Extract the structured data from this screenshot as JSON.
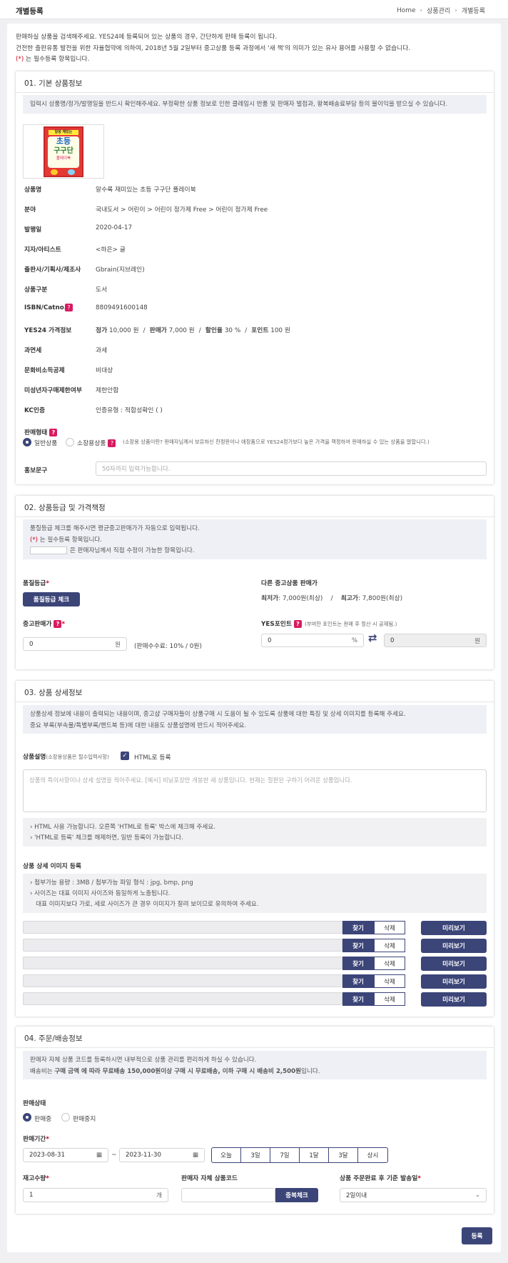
{
  "header": {
    "title": "개별등록",
    "breadcrumb": [
      "Home",
      "상품관리",
      "개별등록"
    ]
  },
  "intro": {
    "line1": "판매하실 상품을 검색해주세요. YES24에 등록되어 있는 상품의 경우, 간단하게 판매 등록이 됩니다.",
    "line2": "건전한 출판유통 발전을 위한 자율협약에 의하여, 2018년 5월 2일부터 중고상품 등록 과정에서 '새 책'의 의미가 있는 유사 용어를 사용할 수 없습니다.",
    "req_mark": "(*)",
    "req_text": " 는 필수등록 항목입니다."
  },
  "sec1": {
    "title": "01. 기본 상품정보",
    "notice": "입력시 상품명/정가/발행일을 반드시 확인해주세요. 부정확한 상품 정보로 인한 클레임시 반품 및 판매자 벌점과, 왕복배송료부담 등의 불이익을 받으실 수 있습니다.",
    "cover": {
      "badge": "알쏭 재밌는",
      "big1": "초등",
      "big2": "구구단",
      "sub": "플레이북"
    },
    "fields": [
      {
        "label": "상품명",
        "value": "알수록 재미있는 초등 구구단 플레이북"
      },
      {
        "label": "분야",
        "value": "국내도서 > 어린이 > 어린이 정가제 Free > 어린이 정가제 Free"
      },
      {
        "label": "발행일",
        "value": "2020-04-17"
      },
      {
        "label": "지자/아티스트",
        "value": "<하은> 글"
      },
      {
        "label": "출판사/기획사/제조사",
        "value": "Gbrain(지브레인)"
      },
      {
        "label": "상품구분",
        "value": "도서"
      },
      {
        "label": "ISBN/Catno.",
        "value": "8809491600148"
      },
      {
        "label": "YES24 가격정보",
        "value": ""
      },
      {
        "label": "과면세",
        "value": "과세"
      },
      {
        "label": "문화비소득공제",
        "value": "비대상"
      },
      {
        "label": "미성년자구매제한여부",
        "value": "제한안함"
      },
      {
        "label": "KC인증",
        "value": "인증유형 : 적합성확인 ( )"
      }
    ],
    "price": {
      "l1": "정가",
      "v1": " 10,000 원",
      "s1": "/",
      "l2": "판매가",
      "v2": " 7,000 원",
      "s2": "/",
      "l3": "할인율",
      "v3": " 30 %",
      "s3": "/",
      "l4": "포인트",
      "v4": " 100 원"
    },
    "sale_type": {
      "label": "판매형태",
      "opt1": "일반상품",
      "opt2": "소장용상품",
      "note": "(소장용 상품이란? 판매자님께서 보유하신 한정판이나 애장품으로 YES24정가보다 높은 가격을 책정하여 판매하실 수 있는 상품을 말합니다.)"
    },
    "promo": {
      "label": "홍보문구",
      "placeholder": "50자까지 입력가능합니다."
    }
  },
  "sec2": {
    "title": "02. 상품등급 및 가격책정",
    "n1": "품질등급 체크를 해주시면 평균중고판매가가 자동으로 입력됩니다.",
    "n2_mark": "(*)",
    "n2": " 는 필수등록 항목입니다.",
    "n3": "은 판매자님께서 직접 수정이 가능한 항목입니다.",
    "grade_label": "품질등급",
    "grade_btn": "품질등급 체크",
    "other_label": "다른 중고상품 판매가",
    "min_l": "최저가",
    "min_v": ": 7,000원(최상)",
    "slash": "/",
    "max_l": "최고가",
    "max_v": ": 7,800원(최상)",
    "used_label": "중고판매가",
    "used_value": "0",
    "won": "원",
    "fee": "(판매수수료: 10% / 0원)",
    "yes_label": "YES포인트",
    "yes_note": "(부여한 포인트는 판매 후 정산 시 공제됨.)",
    "pct_value": "0",
    "pct": "%",
    "swap": "⇄",
    "pt_value": "0",
    "pt_won": "원"
  },
  "sec3": {
    "title": "03. 상품 상세정보",
    "n1": "상품상세 정보에 내용이 출력되는 내용이며, 중고샵 구매자들이 상품구매 시 도움이 될 수 있도록 상품에 대한 특징 및 상세 이미지를 등록해 주세요.",
    "n2": "중요 부록(부속물/특별부록/핸드북 등)에 대한 내용도 상품설명에 반드시 적어주세요.",
    "desc_label": "상품설명",
    "desc_note": "(소장용상품은 필수입력사항)",
    "html_check": "HTML로 등록",
    "desc_placeholder": "상품의 특이사항이나 상세 설명을 적어주세요. [예시] 비닐포장만 개봉한 새 상품입니다. 현재는 절판된 구하기 어려운 상품입니다.",
    "tips": [
      "HTML 사용 가능합니다. 오른쪽 'HTML로 등록' 박스에 체크해 주세요.",
      "'HTML로 등록' 체크를 해제하면, 일반 등록이 가능합니다."
    ],
    "img_label": "상품 상세 이미지 등록",
    "img_tips": [
      "첨부가능 용량 : 3MB / 첨부가능 파일 형식 : jpg, bmp, png",
      "사이즈는 대표 이미지 사이즈와 동일하게 노출됩니다.",
      "대표 이미지보다 가로, 세로 사이즈가 큰 경우 이미지가 잘려 보이므로 유의하여 주세요."
    ],
    "find": "찾기",
    "del": "삭제",
    "preview": "미리보기"
  },
  "sec4": {
    "title": "04. 주문/배송정보",
    "n1": "판매자 자체 상품 코드를 등록하시면 내부적으로 상품 관리를 편리하게 하실 수 있습니다.",
    "n2a": "배송비는 ",
    "n2b": "구매 금액 에 따라 무료배송 150,000원이상 구매 시 무료배송, 이하 구매 시 배송비 2,500원",
    "n2c": "입니다.",
    "status_label": "판매상태",
    "st1": "판매중",
    "st2": "판매중지",
    "period_label": "판매기간",
    "date_from": "2023-08-31",
    "tilde": "~",
    "date_to": "2023-11-30",
    "periods": [
      "오늘",
      "3일",
      "7일",
      "1달",
      "3달",
      "상시"
    ],
    "stock_label": "재고수량",
    "stock_value": "1",
    "unit": "개",
    "code_label": "판매자 자체 상품코드",
    "dup_btn": "중복체크",
    "ship_label": "상품 주문완료 후 기준 발송일",
    "ship_value": "2일이내"
  },
  "submit": "등록",
  "colors": {
    "navy": "#3c4578",
    "required": "#d0021b",
    "help": "#d81b60"
  }
}
